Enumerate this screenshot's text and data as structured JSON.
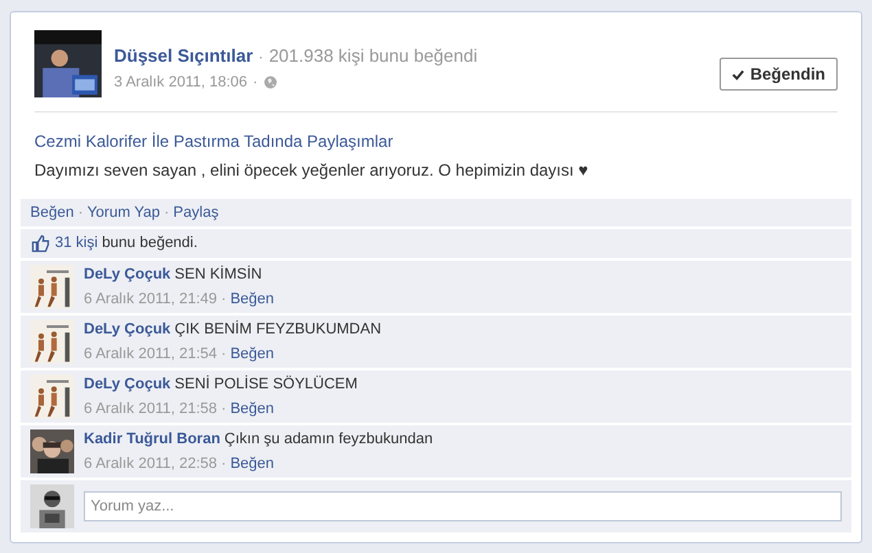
{
  "post": {
    "page_name": "Düşsel Sıçıntılar",
    "page_likes": "201.938 kişi bunu beğendi",
    "separator": "·",
    "timestamp": "3 Aralık 2011, 18:06",
    "like_button": {
      "label": "Beğendin",
      "selected": true
    },
    "link_title": "Cezmi Kalorifer İle Pastırma Tadında Paylaşımlar",
    "message": "Dayımızı seven sayan , elini öpecek yeğenler arıyoruz. O hepimizin dayısı ♥"
  },
  "actions": [
    "Beğen",
    "Yorum Yap",
    "Paylaş"
  ],
  "likes": {
    "count": "31 kişi",
    "text": "bunu beğendi."
  },
  "comments": [
    {
      "author": "DeLy Çoçuk",
      "text": "SEN KİMSİN",
      "time": "6 Aralık 2011, 21:49",
      "like": "Beğen"
    },
    {
      "author": "DeLy Çoçuk",
      "text": "ÇIK BENİM FEYZBUKUMDAN",
      "time": "6 Aralık 2011, 21:54",
      "like": "Beğen"
    },
    {
      "author": "DeLy Çoçuk",
      "text": "SENİ POLİSE SÖYLÜCEM",
      "time": "6 Aralık 2011, 21:58",
      "like": "Beğen"
    },
    {
      "author": "Kadir Tuğrul Boran",
      "text": "Çıkın şu adamın feyzbukundan",
      "time": "6 Aralık 2011, 22:58",
      "like": "Beğen"
    }
  ],
  "comment_box": {
    "placeholder": "Yorum yaz..."
  }
}
